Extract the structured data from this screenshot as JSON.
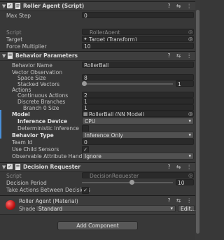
{
  "roller_agent": {
    "title": "Roller Agent (Script)",
    "max_step_label": "Max Step",
    "max_step_value": "0",
    "script_label": "Script",
    "script_value": "RollerAgent",
    "target_label": "Target",
    "target_value": "Target (Transform)",
    "force_label": "Force Multiplier",
    "force_value": "10"
  },
  "behavior_parameters": {
    "title": "Behavior Parameters",
    "behavior_name_label": "Behavior Name",
    "behavior_name_value": "RollerBall",
    "vector_obs_label": "Vector Observation",
    "space_size_label": "Space Size",
    "space_size_value": "8",
    "stacked_vectors_label": "Stacked Vectors",
    "stacked_vectors_value": "1",
    "stacked_vectors_fraction": 0,
    "actions_label": "Actions",
    "continuous_actions_label": "Continuous Actions",
    "continuous_actions_value": "2",
    "discrete_branches_label": "Discrete Branches",
    "discrete_branches_value": "1",
    "branch0_label": "Branch 0 Size",
    "branch0_value": "1",
    "model_label": "Model",
    "model_value": "RollerBall (NN Model)",
    "inference_device_label": "Inference Device",
    "inference_device_value": "CPU",
    "deterministic_label": "Deterministic Inference",
    "behavior_type_label": "Behavior Type",
    "behavior_type_value": "Inference Only",
    "team_id_label": "Team Id",
    "team_id_value": "0",
    "child_sensors_label": "Use Child Sensors",
    "observable_label": "Observable Attribute Handling",
    "observable_value": "Ignore"
  },
  "decision_requester": {
    "title": "Decision Requester",
    "script_label": "Script",
    "script_value": "DecisionRequester",
    "period_label": "Decision Period",
    "period_value": "10",
    "period_fraction": 0.55,
    "take_actions_label": "Take Actions Between Decisions"
  },
  "material": {
    "title": "Roller Agent (Material)",
    "shader_label": "Shader",
    "shader_value": "Standard",
    "edit_label": "Edit..."
  },
  "add_component_label": "Add Component",
  "header_icons": "? ⇆ ⋮",
  "colors": {
    "background": "#383838",
    "header": "#3e3e3e",
    "accent": "#4a90d9",
    "material_ball": "#c41818"
  }
}
